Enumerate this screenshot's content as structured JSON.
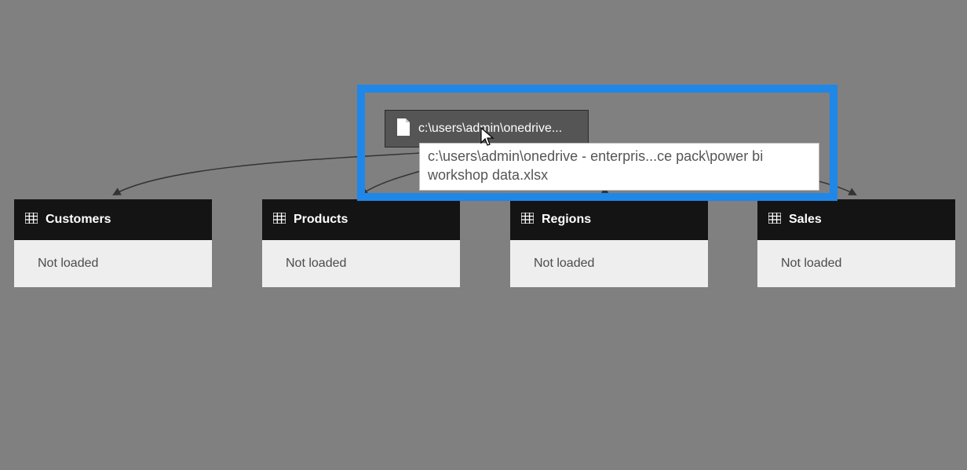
{
  "source": {
    "label": "c:\\users\\admin\\onedrive...",
    "tooltip": "c:\\users\\admin\\onedrive - enterpris...ce pack\\power bi workshop data.xlsx"
  },
  "tables": [
    {
      "name": "Customers",
      "status": "Not loaded"
    },
    {
      "name": "Products",
      "status": "Not loaded"
    },
    {
      "name": "Regions",
      "status": "Not loaded"
    },
    {
      "name": "Sales",
      "status": "Not loaded"
    }
  ]
}
